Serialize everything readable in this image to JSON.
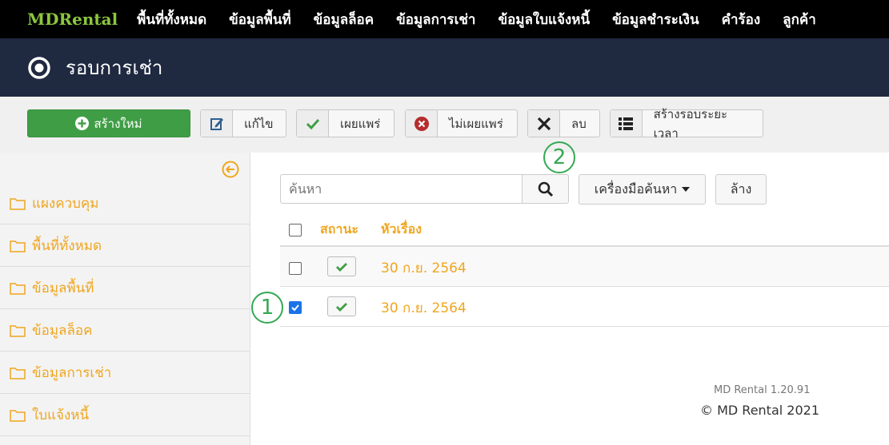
{
  "topnav": {
    "brand": "MDRental",
    "items": [
      "พื้นที่ทั้งหมด",
      "ข้อมูลพื้นที่",
      "ข้อมูลล็อค",
      "ข้อมูลการเช่า",
      "ข้อมูลใบแจ้งหนี้",
      "ข้อมูลชำระเงิน",
      "คำร้อง",
      "ลูกค้า"
    ]
  },
  "titlebar": {
    "title": "รอบการเช่า",
    "icon": "radio-circle-icon"
  },
  "toolbar": {
    "new_label": "สร้างใหม่",
    "edit_label": "แก้ไข",
    "publish_label": "เผยแพร่",
    "unpublish_label": "ไม่เผยแพร่",
    "delete_label": "ลบ",
    "create_period_label": "สร้างรอบระยะเวลา"
  },
  "sidebar": {
    "items": [
      "แผงควบคุม",
      "พื้นที่ทั้งหมด",
      "ข้อมูลพื้นที่",
      "ข้อมูลล็อค",
      "ข้อมูลการเช่า",
      "ใบแจ้งหนี้"
    ]
  },
  "search": {
    "placeholder": "ค้นหา",
    "tools_label": "เครื่องมือค้นหา",
    "clear_label": "ล้าง"
  },
  "table": {
    "headers": {
      "status": "สถานะ",
      "title": "หัวเรื่อง"
    },
    "rows": [
      {
        "title": "30 ก.ย. 2564",
        "checked": false,
        "published": true
      },
      {
        "title": "30 ก.ย. 2564",
        "checked": true,
        "published": true
      }
    ]
  },
  "markers": [
    "1",
    "2"
  ],
  "footer": {
    "version": "MD Rental 1.20.91",
    "copyright": "© MD Rental 2021"
  },
  "colors": {
    "accent": "#f0a61e",
    "success": "#3f9e45",
    "header_bg": "#1f2940",
    "marker": "#34a853"
  }
}
